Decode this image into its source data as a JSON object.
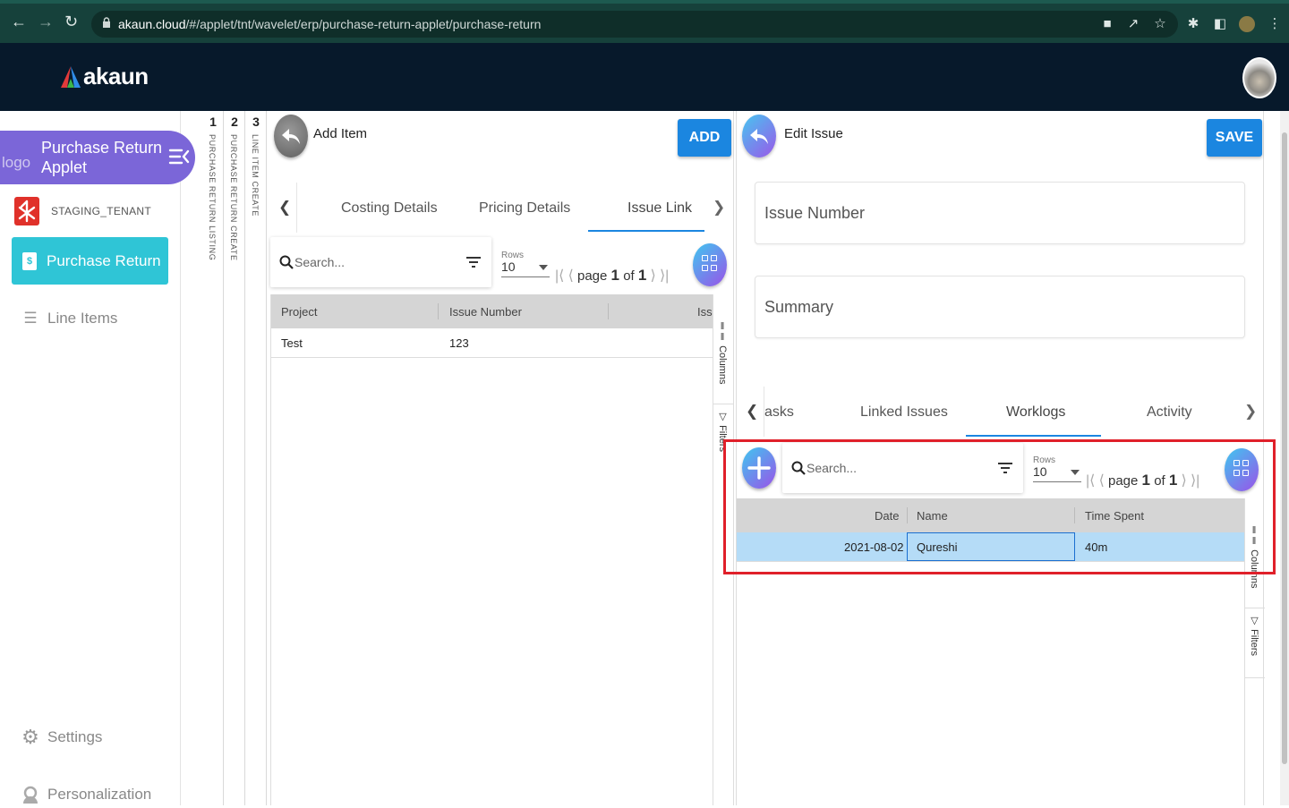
{
  "browser": {
    "url_host": "akaun.cloud",
    "url_path": "/#/applet/tnt/wavelet/erp/purchase-return-applet/purchase-return"
  },
  "header": {
    "logo_text": "akaun"
  },
  "sidebar": {
    "applet_title_line1": "Purchase Return",
    "applet_title_line2": "Applet",
    "broken_logo_alt": "logo",
    "tenant": "STAGING_TENANT",
    "active_item": "Purchase Return",
    "items": [
      {
        "label": "Line Items",
        "icon": "list-icon"
      }
    ],
    "bottom_items": [
      {
        "label": "Settings",
        "icon": "gear-icon"
      },
      {
        "label": "Personalization",
        "icon": "person-icon"
      }
    ]
  },
  "breadcrumbs": [
    {
      "num": "1",
      "label": "PURCHASE RETURN LISTING"
    },
    {
      "num": "2",
      "label": "PURCHASE RETURN CREATE"
    },
    {
      "num": "3",
      "label": "LINE ITEM CREATE"
    }
  ],
  "add_item_panel": {
    "title": "Add Item",
    "add_button": "ADD",
    "tabs": [
      "Costing Details",
      "Pricing Details",
      "Issue Link"
    ],
    "active_tab": "Issue Link",
    "search_placeholder": "Search...",
    "rows_label": "Rows",
    "rows_value": "10",
    "page_word": "page",
    "page_current": "1",
    "of_word": "of",
    "page_total": "1",
    "columns": [
      "Project",
      "Issue Number",
      "Issu"
    ],
    "rows": [
      {
        "project": "Test",
        "issue_number": "123"
      }
    ],
    "side_tools": [
      "Columns",
      "Filters"
    ]
  },
  "edit_issue_panel": {
    "title": "Edit Issue",
    "save_button": "SAVE",
    "fields": {
      "issue_number": "Issue Number",
      "summary": "Summary"
    },
    "tabs": [
      "asks",
      "Linked Issues",
      "Worklogs",
      "Activity"
    ],
    "active_tab": "Worklogs",
    "search_placeholder": "Search...",
    "rows_label": "Rows",
    "rows_value": "10",
    "page_word": "page",
    "page_current": "1",
    "of_word": "of",
    "page_total": "1",
    "columns": [
      "Date",
      "Name",
      "Time Spent"
    ],
    "rows": [
      {
        "date": "2021-08-02",
        "name": "Qureshi",
        "time_spent": "40m"
      }
    ],
    "side_tools": [
      "Columns",
      "Filters"
    ]
  },
  "colors": {
    "browser_bar": "#16413b",
    "app_header": "#07192b",
    "applet_purple": "#7b66d8",
    "active_nav": "#2fc5d6",
    "primary_button": "#1b86e0",
    "selected_row": "#b5dcf7",
    "highlight_box": "#e0202a"
  }
}
